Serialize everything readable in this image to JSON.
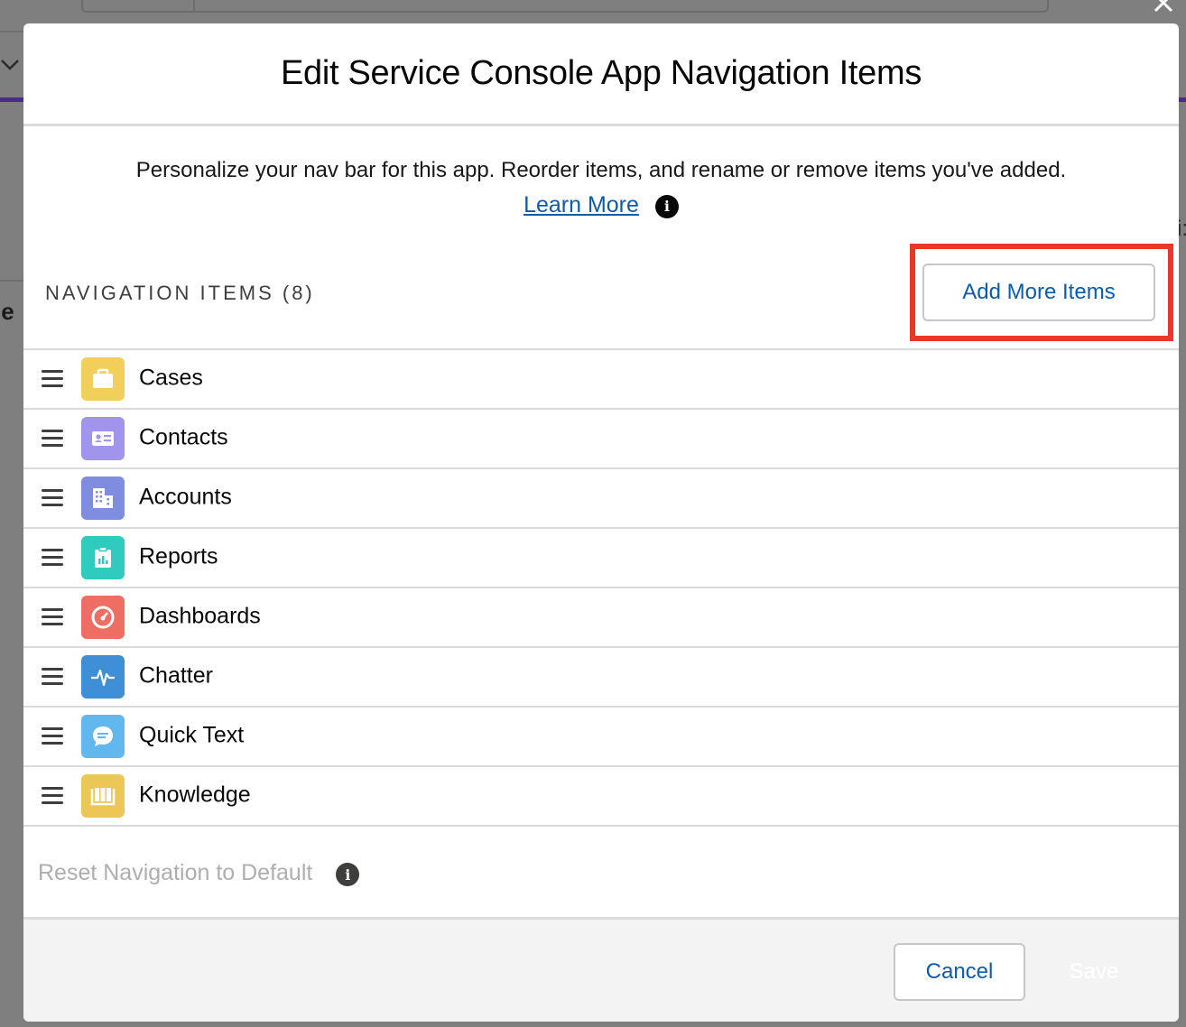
{
  "modal": {
    "title": "Edit Service Console App Navigation Items",
    "intro": "Personalize your nav bar for this app. Reorder items, and rename or remove items you've added.",
    "learn_more": "Learn More",
    "section_label": "NAVIGATION ITEMS (8)",
    "add_more": "Add More Items",
    "reset": "Reset Navigation to Default",
    "cancel": "Cancel",
    "save": "Save"
  },
  "background": {
    "left_fragment": "je",
    "right_fragment": "i:"
  },
  "nav_items": [
    {
      "label": "Cases",
      "icon": "case-icon",
      "color": "#f2cf5b"
    },
    {
      "label": "Contacts",
      "icon": "contact-icon",
      "color": "#a094ed"
    },
    {
      "label": "Accounts",
      "icon": "account-icon",
      "color": "#7f8de1"
    },
    {
      "label": "Reports",
      "icon": "report-icon",
      "color": "#2ecbbe"
    },
    {
      "label": "Dashboards",
      "icon": "dashboard-icon",
      "color": "#ef6e64"
    },
    {
      "label": "Chatter",
      "icon": "chatter-icon",
      "color": "#1b96ff"
    },
    {
      "label": "Quick Text",
      "icon": "quick-text-icon",
      "color": "#62b7ed"
    },
    {
      "label": "Knowledge",
      "icon": "knowledge-icon",
      "color": "#ecc657"
    }
  ],
  "colors": {
    "highlight": "#e8372b",
    "link": "#0b5cab",
    "overlay": "#7f7f7f"
  }
}
